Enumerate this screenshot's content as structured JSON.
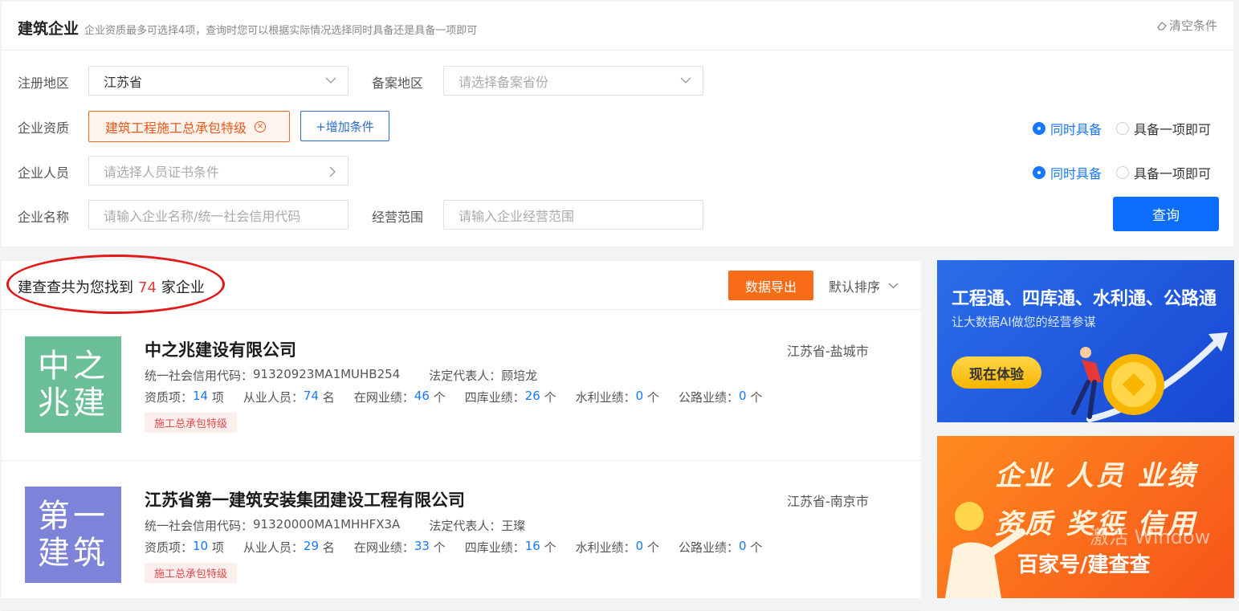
{
  "filter": {
    "title": "建筑企业",
    "subtitle": "企业资质最多可选择4项，查询时您可以根据实际情况选择同时具备还是具备一项即可",
    "clear_label": "清空条件",
    "region_label": "注册地区",
    "region_value": "江苏省",
    "record_label": "备案地区",
    "record_placeholder": "请选择备案省份",
    "qual_label": "企业资质",
    "qual_tag": "建筑工程施工总承包特级",
    "add_label": "+增加条件",
    "person_label": "企业人员",
    "person_placeholder": "请选择人员证书条件",
    "name_label": "企业名称",
    "name_placeholder": "请输入企业名称/统一社会信用代码",
    "scope_label": "经营范围",
    "scope_placeholder": "请输入企业经营范围",
    "radio_all": "同时具备",
    "radio_any": "具备一项即可",
    "query_label": "查询"
  },
  "results": {
    "count_prefix": "建查查共为您找到",
    "count": "74",
    "count_suffix": "家企业",
    "export_label": "数据导出",
    "sort_label": "默认排序",
    "companies": [
      {
        "logo_text": "中之兆建",
        "logo_color": "#6bbf96",
        "name": "中之兆建设有限公司",
        "location": "江苏省-盐城市",
        "credit_code_label": "统一社会信用代码：",
        "credit_code": "91320923MA1MUHB254",
        "legal_label": "法定代表人：",
        "legal": "顾培龙",
        "qual_label": "资质项：",
        "qual_count": "14",
        "qual_unit": "项",
        "staff_label": "从业人员：",
        "staff_count": "74",
        "staff_unit": "名",
        "online_label": "在网业绩：",
        "online_count": "46",
        "unit_ge": "个",
        "siku_label": "四库业绩：",
        "siku_count": "26",
        "water_label": "水利业绩：",
        "water_count": "0",
        "road_label": "公路业绩：",
        "road_count": "0",
        "tag": "施工总承包特级"
      },
      {
        "logo_text": "第一建筑",
        "logo_color": "#7d83d8",
        "name": "江苏省第一建筑安装集团建设工程有限公司",
        "location": "江苏省-南京市",
        "credit_code_label": "统一社会信用代码：",
        "credit_code": "91320000MA1MHHFX3A",
        "legal_label": "法定代表人：",
        "legal": "王璨",
        "qual_label": "资质项：",
        "qual_count": "10",
        "qual_unit": "项",
        "staff_label": "从业人员：",
        "staff_count": "29",
        "staff_unit": "名",
        "online_label": "在网业绩：",
        "online_count": "33",
        "unit_ge": "个",
        "siku_label": "四库业绩：",
        "siku_count": "16",
        "water_label": "水利业绩：",
        "water_count": "0",
        "road_label": "公路业绩：",
        "road_count": "0",
        "tag": "施工总承包特级"
      }
    ]
  },
  "ads": {
    "ad1_title": "工程通、四库通、水利通、公路通",
    "ad1_sub": "让大数据AI做您的经营参谋",
    "ad1_button": "现在体验",
    "ad2_line1": "企业 人员 业绩",
    "ad2_line2": "资质 奖惩 信用",
    "watermark": "百家号/建查查",
    "windows_text": "激活 Window"
  },
  "icons": {
    "clear": "eraser-icon",
    "dropdown": "chevron-down-icon",
    "person_arrow": "chevron-right-icon",
    "tag_remove": "close-circle-icon",
    "sort": "chevron-down-icon"
  }
}
